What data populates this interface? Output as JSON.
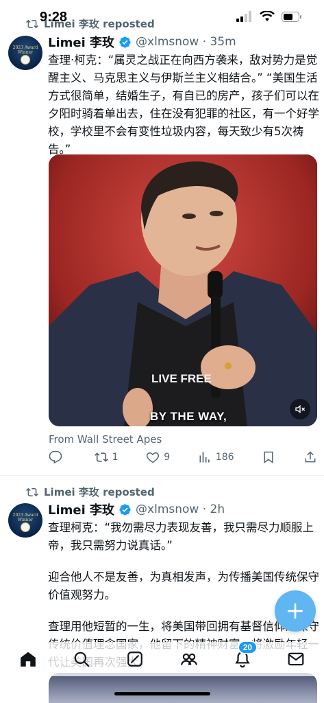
{
  "status_bar": {
    "time": "9:28"
  },
  "tweets": [
    {
      "reposted_by": "Limei 李玫 reposted",
      "avatar_text": "2023 Award Winner",
      "name": "Limei 李玫",
      "handle_time": "@xlmsnow · 35m",
      "paragraphs": [
        "查理·柯克：“属灵之战正在向西方袭来，敌对势力是觉醒主义、马克思主义与伊斯兰主义相结合。” “美国生活方式很简单，结婚生子，有自已的房产，孩子们可以在夕阳时骑着单出去，住在没有犯罪的社区，有一个好学校，学校里不会有变性垃圾内容，每天致少有5次祷告。”"
      ],
      "media": {
        "caption": "BY THE WAY,",
        "shirt_text": "LIVE FREE"
      },
      "source": "From Wall Street Apes",
      "actions": {
        "replies": "",
        "reposts": "1",
        "likes": "9",
        "views": "186"
      }
    },
    {
      "reposted_by": "Limei 李玫 reposted",
      "avatar_text": "2023 Award Winner",
      "name": "Limei 李玫",
      "handle_time": "@xlmsnow · 2h",
      "paragraphs": [
        "查理柯克：“我勿需尽力表现友善，我只需尽力顺服上帝，我只需努力说真话。”",
        "迎合他人不是友善，为真相发声，为传播美国传统保守价值观努力。",
        "查理用他短暂的一生，将美国带回拥有基督信仰的保守传统价值理念国家，他留下的精神财富，将激励年轻一代让美国再次强大。"
      ]
    }
  ],
  "tab_bar": {
    "notifications_badge": "20"
  },
  "colors": {
    "accent": "#1d9bf0",
    "fab": "#5fb6f0",
    "muted": "#536471"
  }
}
